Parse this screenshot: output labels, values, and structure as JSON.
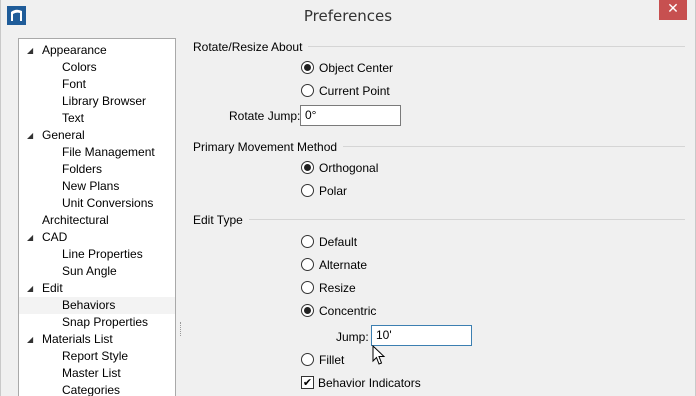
{
  "window": {
    "title": "Preferences",
    "close_glyph": "✕"
  },
  "tree": {
    "items": [
      {
        "label": "Appearance",
        "expandable": true
      },
      {
        "label": "Colors"
      },
      {
        "label": "Font"
      },
      {
        "label": "Library Browser"
      },
      {
        "label": "Text"
      },
      {
        "label": "General",
        "expandable": true
      },
      {
        "label": "File Management"
      },
      {
        "label": "Folders"
      },
      {
        "label": "New Plans"
      },
      {
        "label": "Unit Conversions"
      },
      {
        "label": "Architectural"
      },
      {
        "label": "CAD",
        "expandable": true
      },
      {
        "label": "Line Properties"
      },
      {
        "label": "Sun Angle"
      },
      {
        "label": "Edit",
        "expandable": true
      },
      {
        "label": "Behaviors",
        "selected": true
      },
      {
        "label": "Snap Properties"
      },
      {
        "label": "Materials List",
        "expandable": true
      },
      {
        "label": "Report Style"
      },
      {
        "label": "Master List"
      },
      {
        "label": "Categories"
      }
    ],
    "expanded_arrow_glyph": "◢"
  },
  "rotate": {
    "title": "Rotate/Resize About",
    "options": [
      {
        "label": "Object Center",
        "checked": true
      },
      {
        "label": "Current Point",
        "checked": false
      }
    ],
    "jump_label": "Rotate Jump:",
    "jump_value": "0°"
  },
  "movement": {
    "title": "Primary Movement Method",
    "options": [
      {
        "label": "Orthogonal",
        "checked": true
      },
      {
        "label": "Polar",
        "checked": false
      }
    ]
  },
  "edit_type": {
    "title": "Edit Type",
    "options": [
      {
        "label": "Default",
        "checked": false
      },
      {
        "label": "Alternate",
        "checked": false
      },
      {
        "label": "Resize",
        "checked": false
      },
      {
        "label": "Concentric",
        "checked": true
      },
      {
        "label": "Fillet",
        "checked": false
      }
    ],
    "jump_label": "Jump:",
    "jump_value": "10'",
    "behavior_indicators_label": "Behavior Indicators",
    "behavior_indicators_checked": true,
    "check_glyph": "✔"
  },
  "colors": {
    "close_button": "#c75050",
    "focus_border": "#3c7fb1",
    "app_icon": "#1f5c99"
  },
  "icons": {
    "app": "app-logo-icon",
    "close": "close-icon",
    "cursor": "mouse-pointer-icon"
  }
}
